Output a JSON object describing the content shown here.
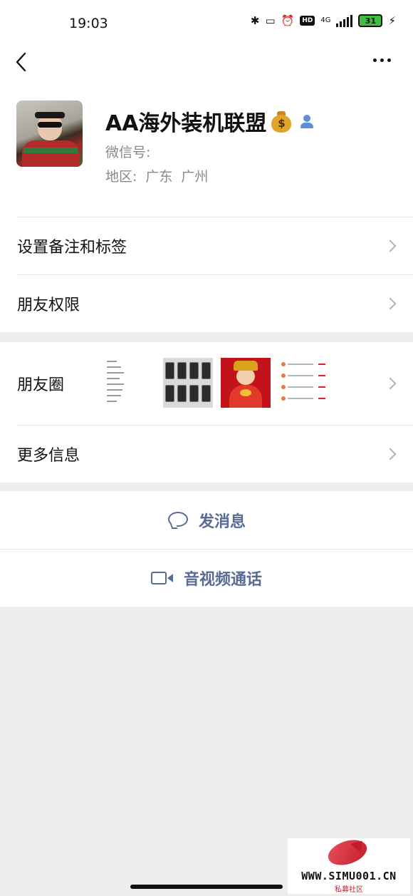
{
  "status_bar": {
    "time": "19:03",
    "network": "4G",
    "battery_level": "31",
    "icons": [
      "bluetooth-icon",
      "vibrate-icon",
      "alarm-icon",
      "hd-icon",
      "signal-icon",
      "battery-icon",
      "charging-icon"
    ],
    "hd_label": "HD"
  },
  "nav": {
    "back_icon": "chevron-left-icon",
    "more_icon": "more-dots-icon"
  },
  "profile": {
    "name": "AA海外装机联盟",
    "name_emoji": "money-bag-icon",
    "wechat_id_label": "微信号:",
    "region_label": "地区:",
    "region_province": "广东",
    "region_city": "广州"
  },
  "menu": {
    "remark_tags": "设置备注和标签",
    "friend_permissions": "朋友权限",
    "moments": "朋友圈",
    "more_info": "更多信息"
  },
  "actions": {
    "send_message": "发消息",
    "av_call": "音视频通话"
  },
  "watermark": {
    "site": "WWW.SIMU001.CN",
    "subtitle": "私募社区"
  },
  "colors": {
    "link_blue": "#576b95",
    "background": "#ededed",
    "secondary_text": "#888888"
  }
}
